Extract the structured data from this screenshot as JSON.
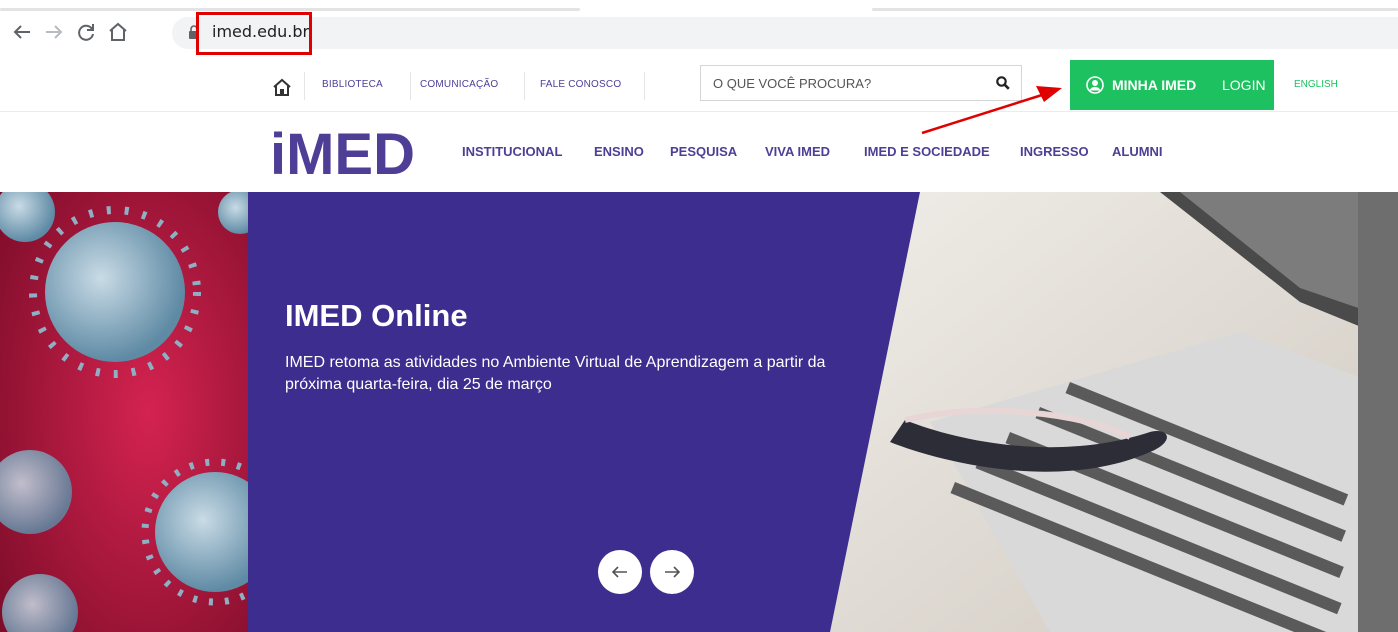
{
  "browser": {
    "url": "imed.edu.br",
    "back_icon": "arrow-left-icon",
    "forward_icon": "arrow-right-icon",
    "reload_icon": "reload-icon",
    "home_icon": "home-icon"
  },
  "topbar": {
    "links": [
      {
        "label": "BIBLIOTECA"
      },
      {
        "label": "COMUNICAÇÃO"
      },
      {
        "label": "FALE CONOSCO"
      }
    ],
    "search": {
      "placeholder": "O QUE VOCÊ PROCURA?"
    },
    "login": {
      "bold_label": "MINHA IMED",
      "light_label": "LOGIN"
    },
    "english_label": "ENGLISH"
  },
  "mainnav": {
    "logo_text": "iMED",
    "items": [
      {
        "label": "INSTITUCIONAL"
      },
      {
        "label": "ENSINO"
      },
      {
        "label": "PESQUISA"
      },
      {
        "label": "VIVA IMED"
      },
      {
        "label": "IMED E SOCIEDADE"
      },
      {
        "label": "INGRESSO"
      },
      {
        "label": "ALUMNI"
      }
    ]
  },
  "hero": {
    "title": "IMED Online",
    "text": "IMED retoma as atividades no Ambiente Virtual de Aprendizagem a partir da próxima quarta-feira, dia 25 de março",
    "prev_label": "←",
    "next_label": "→"
  },
  "colors": {
    "brand_purple": "#3c2d8e",
    "nav_purple": "#4e3e96",
    "login_green": "#1ec15f",
    "annotation_red": "#e00000"
  }
}
